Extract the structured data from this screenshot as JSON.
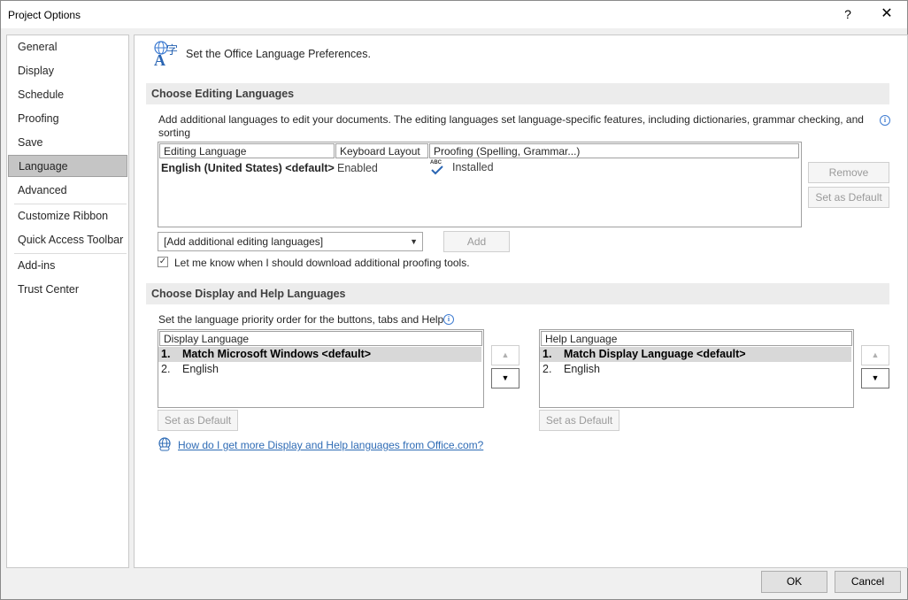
{
  "window": {
    "title": "Project Options",
    "help_glyph": "?",
    "close_glyph": "✕"
  },
  "sidebar": {
    "items": [
      {
        "label": "General"
      },
      {
        "label": "Display"
      },
      {
        "label": "Schedule"
      },
      {
        "label": "Proofing"
      },
      {
        "label": "Save"
      },
      {
        "label": "Language",
        "selected": true
      },
      {
        "label": "Advanced"
      },
      {
        "label": "Customize Ribbon"
      },
      {
        "label": "Quick Access Toolbar"
      },
      {
        "label": "Add-ins"
      },
      {
        "label": "Trust Center"
      }
    ]
  },
  "header": {
    "text": "Set the Office Language Preferences.",
    "icon": "language-icon",
    "glyph": "字"
  },
  "editing": {
    "section_title": "Choose Editing Languages",
    "description": "Add additional languages to edit your documents. The editing languages set language-specific features, including dictionaries, grammar checking, and sorting",
    "columns": [
      "Editing Language",
      "Keyboard Layout",
      "Proofing (Spelling, Grammar...)"
    ],
    "rows": [
      {
        "language": "English (United States) <default>",
        "keyboard": "Enabled",
        "proofing": "Installed",
        "proof_icon_text": "ABC"
      }
    ],
    "remove_label": "Remove",
    "set_default_label": "Set as Default",
    "add_dropdown_value": "[Add additional editing languages]",
    "add_label": "Add",
    "checkbox_label": "Let me know when I should download additional proofing tools.",
    "checkbox_checked": true
  },
  "display": {
    "section_title": "Choose Display and Help Languages",
    "description": "Set the language priority order for the buttons, tabs and Help",
    "display_header": "Display Language",
    "display_items": [
      {
        "num": "1.",
        "label": "Match Microsoft Windows <default>"
      },
      {
        "num": "2.",
        "label": "English"
      }
    ],
    "help_header": "Help Language",
    "help_items": [
      {
        "num": "1.",
        "label": "Match Display Language <default>"
      },
      {
        "num": "2.",
        "label": "English"
      }
    ],
    "set_default_label": "Set as Default",
    "up_glyph": "▲",
    "down_glyph": "▼",
    "link_text": "How do I get more Display and Help languages from Office.com?"
  },
  "footer": {
    "ok_label": "OK",
    "cancel_label": "Cancel"
  },
  "colors": {
    "selected_nav": "#c5c5c5",
    "link": "#2e6bb5",
    "accent": "#3d7bd1"
  }
}
